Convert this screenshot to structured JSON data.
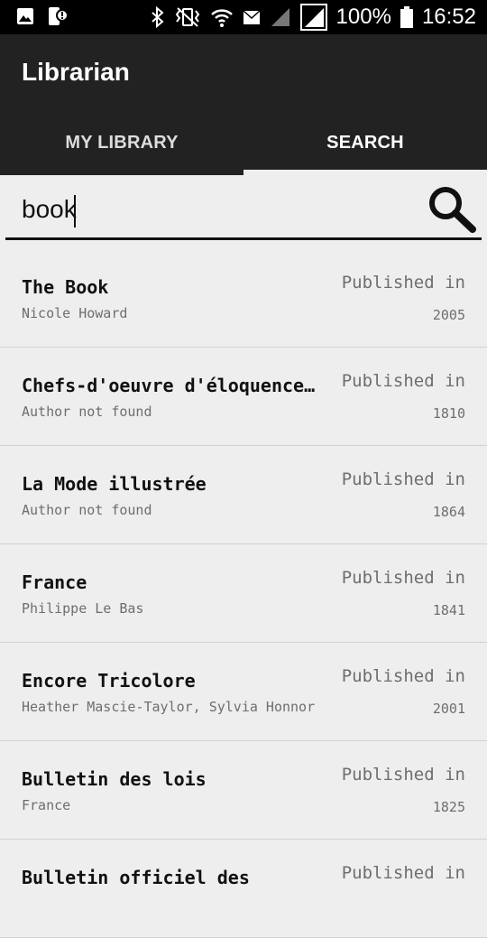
{
  "status_bar": {
    "battery_percent": "100%",
    "time": "16:52",
    "icons": [
      "image-icon",
      "phone-alert-icon",
      "bluetooth-icon",
      "vibrate-icon",
      "wifi-icon",
      "message-icon",
      "signal-icon",
      "signal-icon",
      "battery-icon"
    ]
  },
  "app_bar": {
    "title": "Librarian"
  },
  "tabs": [
    {
      "label": "MY LIBRARY",
      "active": false
    },
    {
      "label": "SEARCH",
      "active": true
    }
  ],
  "search": {
    "value": "book",
    "icon": "search-icon"
  },
  "results": [
    {
      "title": "The Book",
      "author": "Nicole Howard",
      "published_label": "Published in",
      "year": "2005"
    },
    {
      "title": "Chefs-d'oeuvre d'éloquence…",
      "author": "Author not found",
      "published_label": "Published in",
      "year": "1810"
    },
    {
      "title": "La Mode illustrée",
      "author": "Author not found",
      "published_label": "Published in",
      "year": "1864"
    },
    {
      "title": "France",
      "author": "Philippe Le Bas",
      "published_label": "Published in",
      "year": "1841"
    },
    {
      "title": "Encore Tricolore",
      "author": "Heather Mascie-Taylor, Sylvia Honnor",
      "published_label": "Published in",
      "year": "2001"
    },
    {
      "title": "Bulletin des lois",
      "author": "France",
      "published_label": "Published in",
      "year": "1825"
    },
    {
      "title": "Bulletin officiel des",
      "author": "",
      "published_label": "Published in",
      "year": ""
    }
  ],
  "colors": {
    "status_bar": "#000000",
    "app_bar": "#222222",
    "background": "#eeeeee",
    "secondary_text": "#6e6e6e"
  }
}
